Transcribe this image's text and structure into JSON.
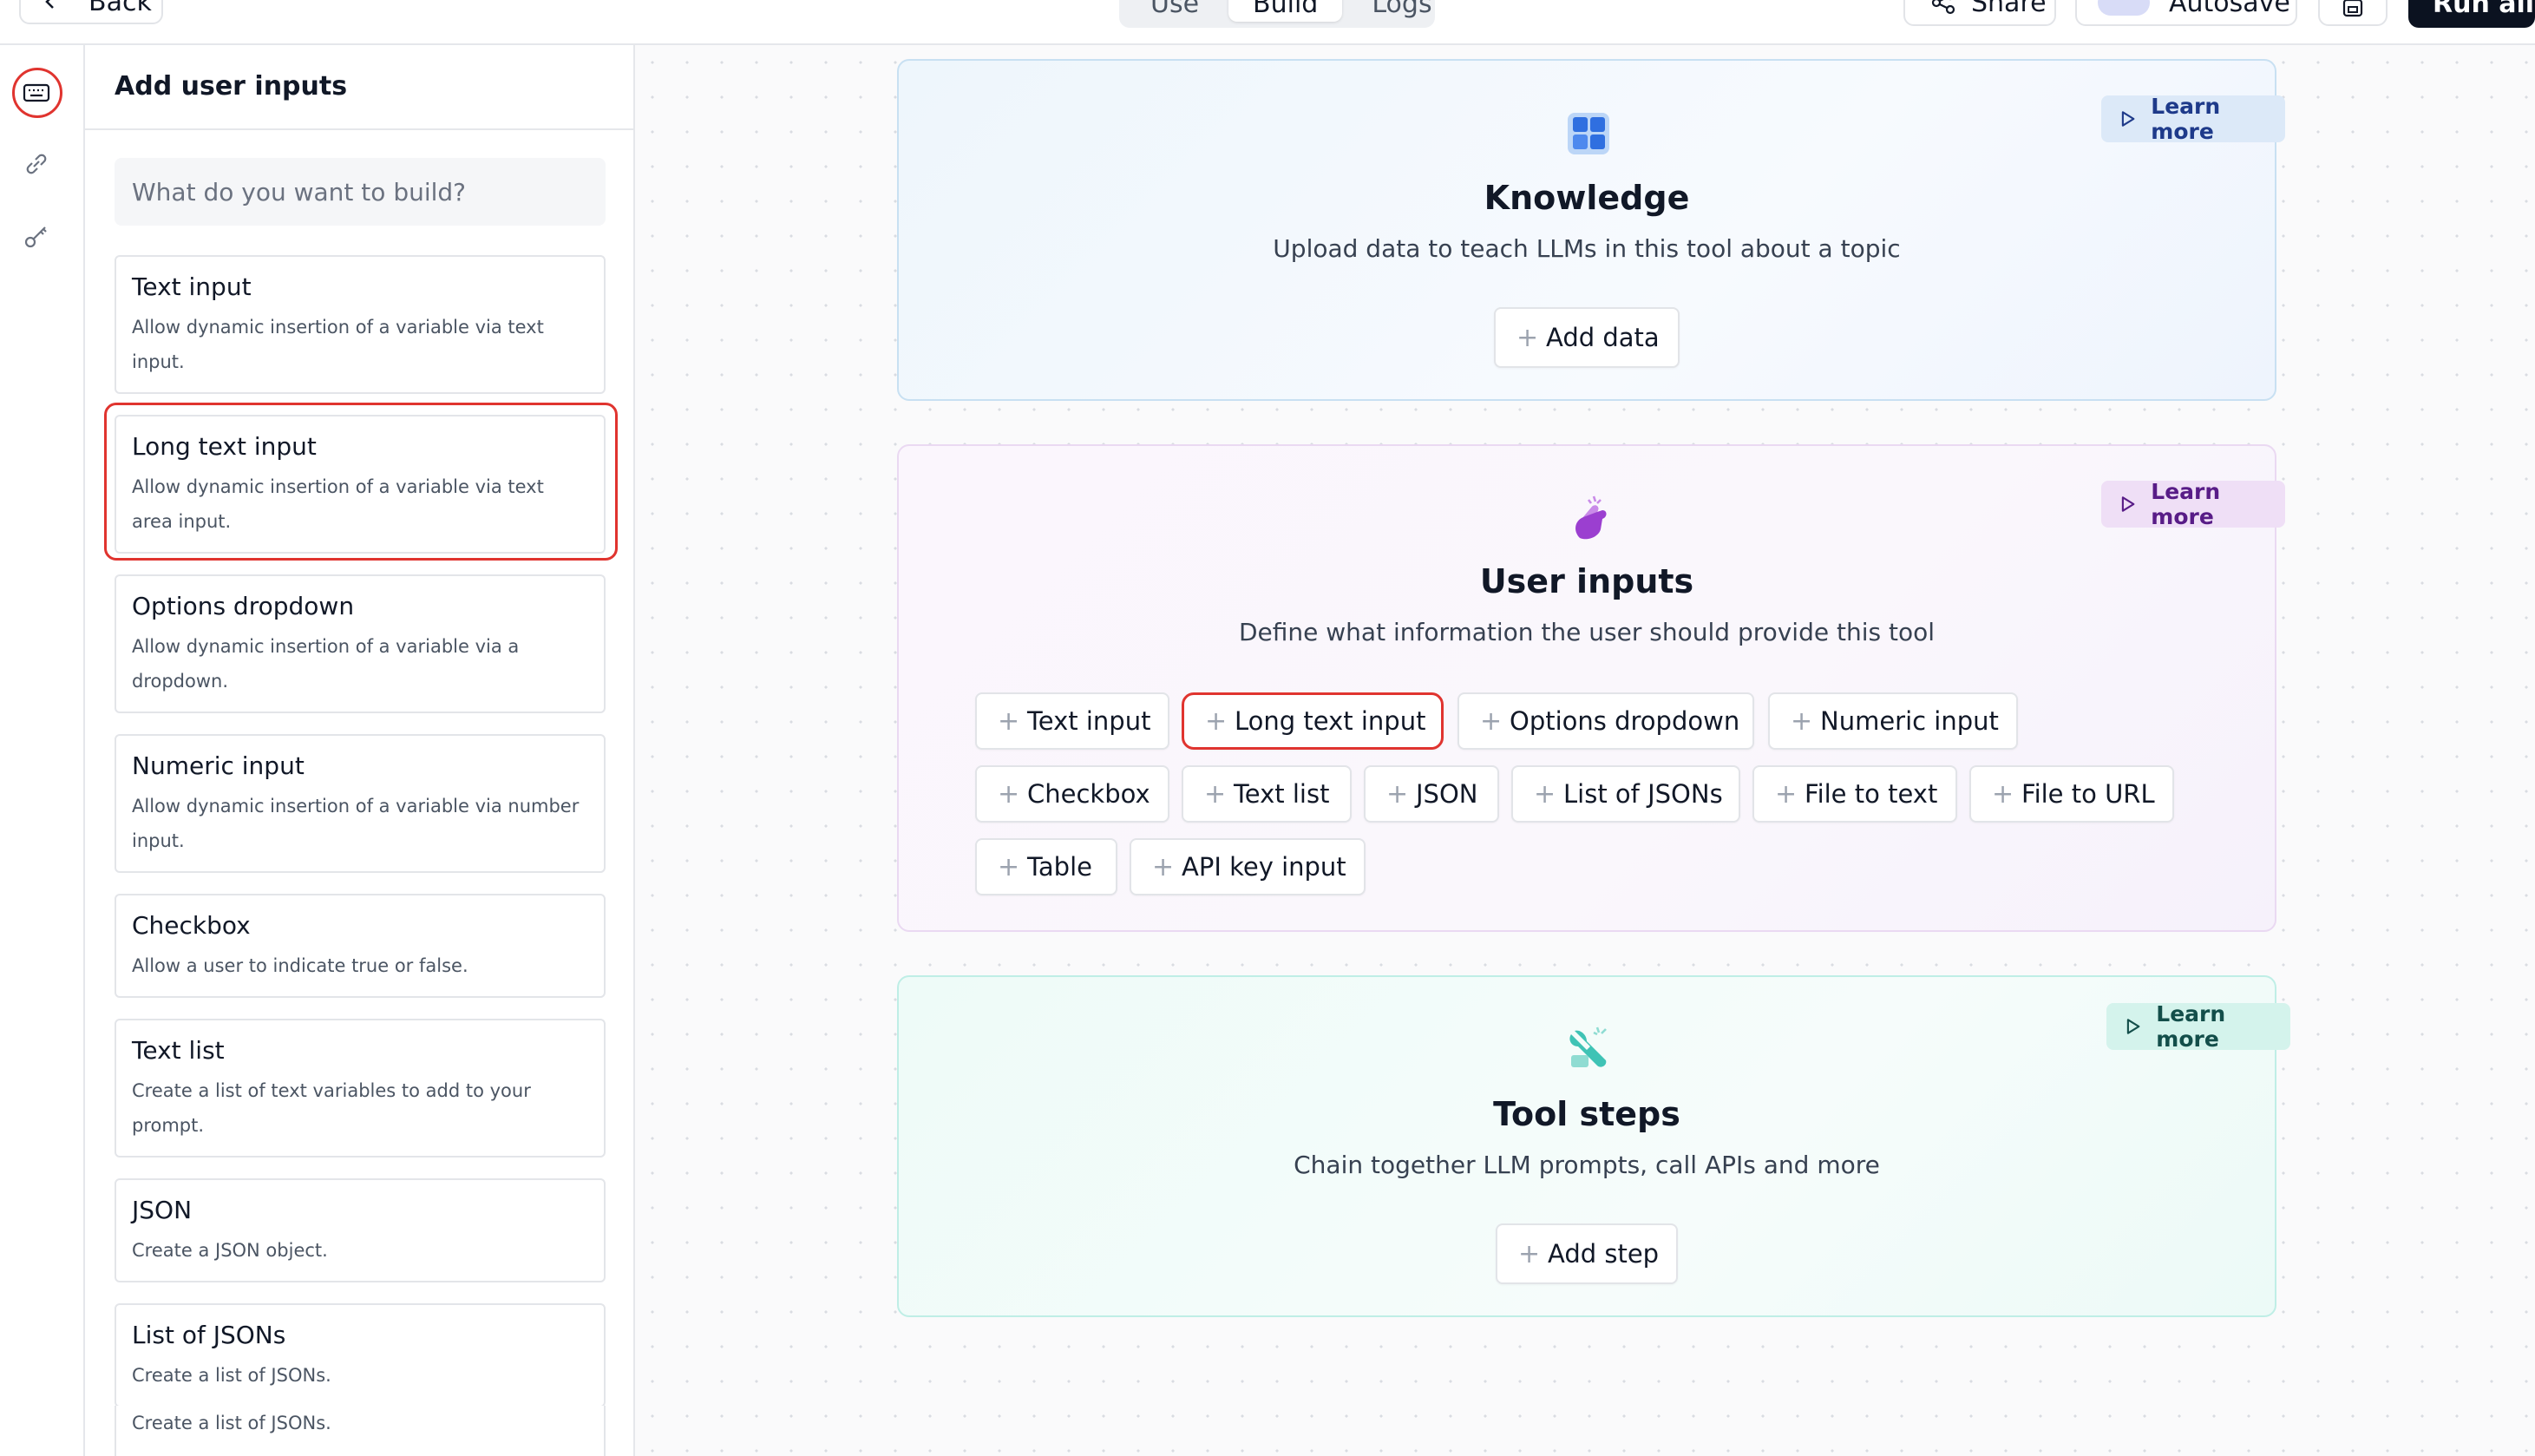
{
  "topbar": {
    "back_label": "Back",
    "tabs": [
      {
        "label": "Use",
        "active": false
      },
      {
        "label": "Build",
        "active": true
      },
      {
        "label": "Logs",
        "active": false
      }
    ],
    "share_label": "Share",
    "autosave_label": "Autosave",
    "run_label": "Run all"
  },
  "rail": {
    "icons": [
      "keyboard-icon",
      "link-icon",
      "key-icon"
    ]
  },
  "panel": {
    "title": "Add user inputs",
    "search_placeholder": "What do you want to build?",
    "items": [
      {
        "title": "Text input",
        "desc": "Allow dynamic insertion of a variable via text input."
      },
      {
        "title": "Long text input",
        "desc": "Allow dynamic insertion of a variable via text area input."
      },
      {
        "title": "Options dropdown",
        "desc": "Allow dynamic insertion of a variable via a dropdown."
      },
      {
        "title": "Numeric input",
        "desc": "Allow dynamic insertion of a variable via number input."
      },
      {
        "title": "Checkbox",
        "desc": "Allow a user to indicate true or false."
      },
      {
        "title": "Text list",
        "desc": "Create a list of text variables to add to your prompt."
      },
      {
        "title": "JSON",
        "desc": "Create a JSON object."
      },
      {
        "title": "List of JSONs",
        "desc": "Create a list of JSONs."
      },
      {
        "title": "",
        "desc": "Create a list of JSONs."
      }
    ]
  },
  "knowledge": {
    "title": "Knowledge",
    "subtitle": "Upload data to teach LLMs in this tool about a topic",
    "learn_more": "Learn more",
    "add_label": "Add data"
  },
  "inputs": {
    "title": "User inputs",
    "subtitle": "Define what information the user should provide this tool",
    "learn_more": "Learn more",
    "buttons": [
      "Text input",
      "Long text input",
      "Options dropdown",
      "Numeric input",
      "Checkbox",
      "Text list",
      "JSON",
      "List of JSONs",
      "File to text",
      "File to URL",
      "Table",
      "API key input"
    ]
  },
  "steps": {
    "title": "Tool steps",
    "subtitle": "Chain together LLM prompts, call APIs and more",
    "learn_more": "Learn more",
    "add_label": "Add step"
  },
  "colors": {
    "highlight": "#e0342f",
    "run_button": "#0b1220",
    "knowledge_accent": "#2f6fe0",
    "inputs_accent": "#9b3fd0",
    "steps_accent": "#3fc3b5"
  }
}
